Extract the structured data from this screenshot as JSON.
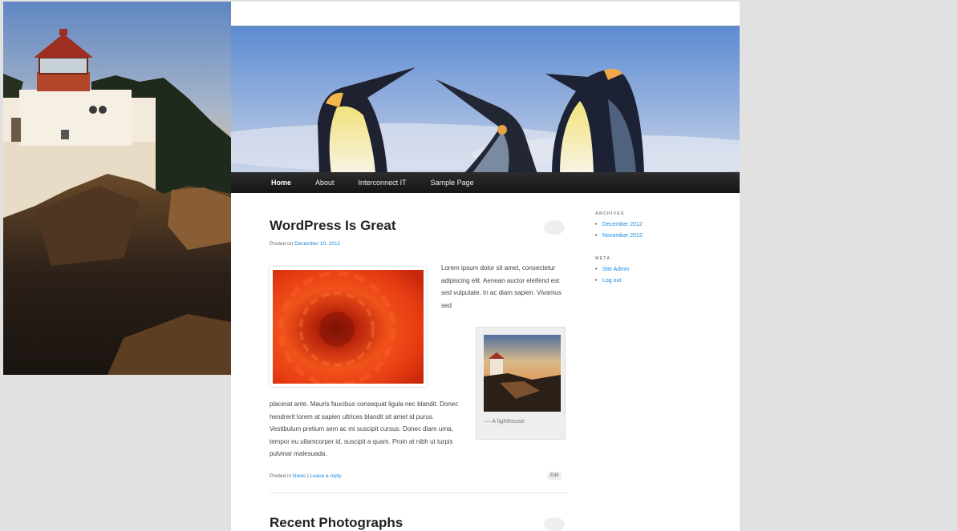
{
  "nav": {
    "items": [
      {
        "label": "Home",
        "current": true
      },
      {
        "label": "About",
        "current": false
      },
      {
        "label": "Interconnect IT",
        "current": false
      },
      {
        "label": "Sample Page",
        "current": false
      }
    ]
  },
  "posts": [
    {
      "title": "WordPress Is Great",
      "meta_prefix": "Posted on",
      "meta_date": "December 10, 2012",
      "text_right": "Lorem ipsum dolor sit amet, consectetur adipiscing elit. Aenean auctor eleifend est sed vulputate. In ac diam sapien. Vivamus sed",
      "text_bottom": "placerat ante. Mauris faucibus consequat ligula nec blandit. Donec hendrerit lorem at sapien ultrices blandit sit amet id purus. Vestibulum pretium sem ac mi suscipit cursus. Donec diam urna, tempor eu ullamcorper id, suscipit a quam. Proin at nibh ut turpis pulvinar malesuada.",
      "caption": "A lighthouse",
      "footer_prefix": "Posted in",
      "footer_category": "News",
      "footer_sep": "|",
      "footer_reply": "Leave a reply",
      "edit_label": "Edit"
    },
    {
      "title": "Recent Photographs"
    }
  ],
  "sidebar": {
    "archives": {
      "title": "Archives",
      "items": [
        "December 2012",
        "November 2012"
      ]
    },
    "meta": {
      "title": "Meta",
      "items": [
        "Site Admin",
        "Log out"
      ]
    }
  }
}
